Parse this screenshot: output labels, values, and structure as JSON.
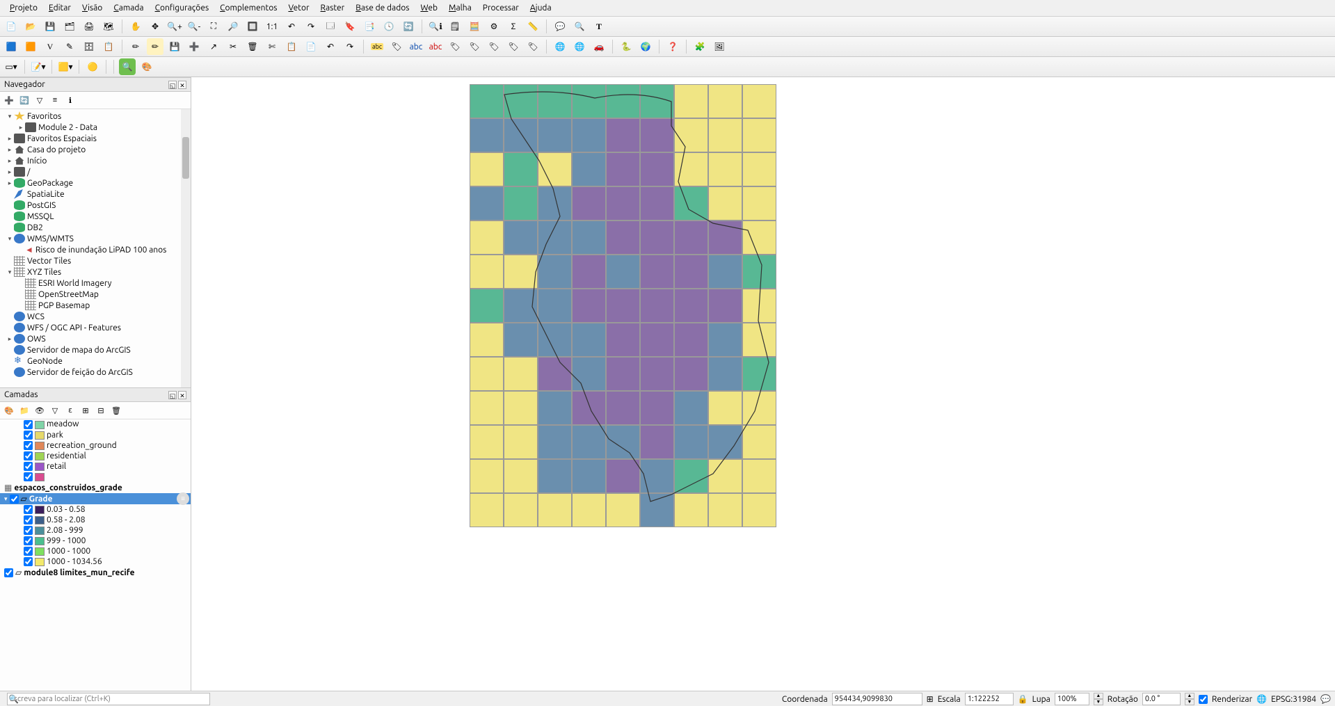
{
  "menu": [
    "Projeto",
    "Editar",
    "Visão",
    "Camada",
    "Configurações",
    "Complementos",
    "Vetor",
    "Raster",
    "Base de dados",
    "Web",
    "Malha",
    "Processar",
    "Ajuda"
  ],
  "menuAccel": [
    "P",
    "E",
    "V",
    "C",
    "C",
    "C",
    "V",
    "R",
    "B",
    "W",
    "M",
    "",
    "A"
  ],
  "panels": {
    "browserTitle": "Navegador",
    "layersTitle": "Camadas"
  },
  "browser": [
    {
      "exp": "▾",
      "icon": "star",
      "label": "Favoritos",
      "ind": 0
    },
    {
      "exp": "▸",
      "icon": "folder",
      "label": "Module 2 - Data",
      "ind": 1
    },
    {
      "exp": "▸",
      "icon": "folder",
      "label": "Favoritos Espaciais",
      "ind": 0
    },
    {
      "exp": "▸",
      "icon": "home",
      "label": "Casa do projeto",
      "ind": 0
    },
    {
      "exp": "▸",
      "icon": "home",
      "label": "Início",
      "ind": 0
    },
    {
      "exp": "▸",
      "icon": "folder",
      "label": "/",
      "ind": 0
    },
    {
      "exp": "▸",
      "icon": "db",
      "label": "GeoPackage",
      "ind": 0
    },
    {
      "exp": "",
      "icon": "feather",
      "label": "SpatiaLite",
      "ind": 0
    },
    {
      "exp": "",
      "icon": "db",
      "label": "PostGIS",
      "ind": 0
    },
    {
      "exp": "",
      "icon": "db",
      "label": "MSSQL",
      "ind": 0
    },
    {
      "exp": "",
      "icon": "db",
      "label": "DB2",
      "ind": 0
    },
    {
      "exp": "▾",
      "icon": "globe",
      "label": "WMS/WMTS",
      "ind": 0
    },
    {
      "exp": "",
      "icon": "",
      "label": "Risco de inundação LiPAD 100 anos",
      "ind": 1,
      "pre": "◄"
    },
    {
      "exp": "",
      "icon": "grid",
      "label": "Vector Tiles",
      "ind": 0
    },
    {
      "exp": "▾",
      "icon": "grid",
      "label": "XYZ Tiles",
      "ind": 0
    },
    {
      "exp": "",
      "icon": "grid",
      "label": "ESRI World Imagery",
      "ind": 1
    },
    {
      "exp": "",
      "icon": "grid",
      "label": "OpenStreetMap",
      "ind": 1
    },
    {
      "exp": "",
      "icon": "grid",
      "label": "PGP Basemap",
      "ind": 1
    },
    {
      "exp": "",
      "icon": "globe",
      "label": "WCS",
      "ind": 0
    },
    {
      "exp": "",
      "icon": "globe",
      "label": "WFS / OGC API - Features",
      "ind": 0
    },
    {
      "exp": "▸",
      "icon": "globe",
      "label": "OWS",
      "ind": 0
    },
    {
      "exp": "",
      "icon": "globe",
      "label": "Servidor de mapa do ArcGIS",
      "ind": 0
    },
    {
      "exp": "",
      "icon": "snow",
      "label": "GeoNode",
      "ind": 0
    },
    {
      "exp": "",
      "icon": "globe",
      "label": "Servidor de feição do ArcGIS",
      "ind": 0
    }
  ],
  "layers": [
    {
      "chk": true,
      "sw": "#7fd4a7",
      "label": "meadow",
      "ind": 2,
      "cut": true
    },
    {
      "chk": true,
      "sw": "#e6d96b",
      "label": "park",
      "ind": 2
    },
    {
      "chk": true,
      "sw": "#e0885a",
      "label": "recreation_ground",
      "ind": 2
    },
    {
      "chk": true,
      "sw": "#9fd455",
      "label": "residential",
      "ind": 2
    },
    {
      "chk": true,
      "sw": "#9a55c7",
      "label": "retail",
      "ind": 2
    },
    {
      "chk": true,
      "sw": "#d94c8f",
      "label": "",
      "ind": 2
    },
    {
      "chk": null,
      "sw": null,
      "label": "espacos_construidos_grade",
      "ind": 0,
      "bold": true,
      "tbl": true
    },
    {
      "chk": true,
      "sw": null,
      "label": "Grade",
      "ind": 0,
      "bold": true,
      "sel": true,
      "poly": true
    },
    {
      "chk": true,
      "sw": "#3b1e5c",
      "label": "0.03 - 0.58",
      "ind": 2
    },
    {
      "chk": true,
      "sw": "#3d5f8a",
      "label": "0.58 - 2.08",
      "ind": 2
    },
    {
      "chk": true,
      "sw": "#4b8f9b",
      "label": "2.08 - 999",
      "ind": 2
    },
    {
      "chk": true,
      "sw": "#4bbf8f",
      "label": "999 - 1000",
      "ind": 2
    },
    {
      "chk": true,
      "sw": "#7ee060",
      "label": "1000 - 1000",
      "ind": 2
    },
    {
      "chk": true,
      "sw": "#f2e96b",
      "label": "1000 - 1034.56",
      "ind": 2
    },
    {
      "chk": true,
      "sw": null,
      "label": "module8 limites_mun_recife",
      "ind": 0,
      "bold": true,
      "poly2": true
    }
  ],
  "mapCells": [
    [
      "g",
      "g",
      "g",
      "g",
      "g",
      "g",
      "y",
      "y",
      "y"
    ],
    [
      "b",
      "b",
      "b",
      "b",
      "v",
      "v",
      "y",
      "y",
      "y"
    ],
    [
      "y",
      "g",
      "y",
      "b",
      "v",
      "v",
      "y",
      "y",
      "y"
    ],
    [
      "b",
      "g",
      "b",
      "v",
      "v",
      "v",
      "g",
      "y",
      "y"
    ],
    [
      "y",
      "b",
      "b",
      "b",
      "v",
      "v",
      "v",
      "v",
      "y"
    ],
    [
      "y",
      "y",
      "b",
      "v",
      "b",
      "v",
      "v",
      "b",
      "g"
    ],
    [
      "g",
      "b",
      "b",
      "v",
      "v",
      "v",
      "v",
      "v",
      "y"
    ],
    [
      "y",
      "b",
      "b",
      "b",
      "v",
      "v",
      "v",
      "b",
      "y"
    ],
    [
      "y",
      "y",
      "v",
      "b",
      "v",
      "v",
      "v",
      "b",
      "g"
    ],
    [
      "y",
      "y",
      "b",
      "v",
      "v",
      "v",
      "b",
      "y",
      "y"
    ],
    [
      "y",
      "y",
      "b",
      "b",
      "b",
      "v",
      "b",
      "b",
      "y"
    ],
    [
      "y",
      "y",
      "b",
      "b",
      "v",
      "b",
      "g",
      "y",
      "y"
    ],
    [
      "y",
      "y",
      "y",
      "y",
      "y",
      "b",
      "y",
      "y",
      "y"
    ]
  ],
  "mapColors": {
    "g": "#58b894",
    "b": "#6a8fae",
    "v": "#8a6fa8",
    "y": "#f0e584"
  },
  "status": {
    "coordLabel": "Coordenada",
    "coordValue": "954434,9099830",
    "scaleLabel": "Escala",
    "scaleValue": "1:122252",
    "lupaLabel": "Lupa",
    "lupaValue": "100%",
    "rotLabel": "Rotação",
    "rotValue": "0.0 °",
    "renderLabel": "Renderizar",
    "epsg": "EPSG:31984"
  },
  "locatorPlaceholder": "Escreva para localizar (Ctrl+K)"
}
